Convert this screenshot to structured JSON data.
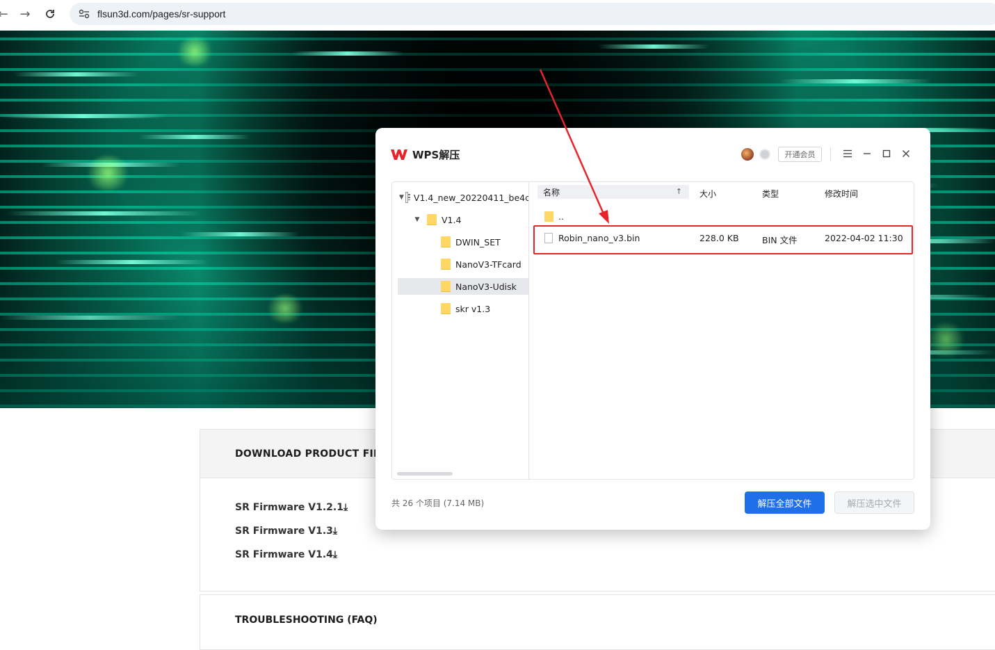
{
  "browser": {
    "url": "flsun3d.com/pages/sr-support"
  },
  "page": {
    "firmware_section_title": "DOWNLOAD PRODUCT FIRMWARE",
    "firmware_links": [
      "SR Firmware V1.2.1⤓",
      "SR Firmware V1.3⤓",
      "SR Firmware V1.4⤓"
    ],
    "faq_title": "TROUBLESHOOTING (FAQ)"
  },
  "dialog": {
    "title": "WPS解压",
    "vip_label": "开通会员",
    "tree": [
      {
        "label": "V1.4_new_20220411_be4c",
        "level": 0,
        "kind": "archive",
        "expanded": true
      },
      {
        "label": "V1.4",
        "level": 1,
        "kind": "folder",
        "expanded": true
      },
      {
        "label": "DWIN_SET",
        "level": 2,
        "kind": "folder"
      },
      {
        "label": "NanoV3-TFcard",
        "level": 2,
        "kind": "folder"
      },
      {
        "label": "NanoV3-Udisk",
        "level": 2,
        "kind": "folder",
        "selected": true
      },
      {
        "label": "skr v1.3",
        "level": 2,
        "kind": "folder"
      }
    ],
    "columns": {
      "name": "名称",
      "size": "大小",
      "type": "类型",
      "modified": "修改时间"
    },
    "rows": [
      {
        "name": "..",
        "size": "",
        "type": "",
        "modified": "",
        "kind": "folder"
      },
      {
        "name": "Robin_nano_v3.bin",
        "size": "228.0 KB",
        "type": "BIN 文件",
        "modified": "2022-04-02 11:30",
        "kind": "file"
      }
    ],
    "footer_count": "共 26 个项目 (7.14 MB)",
    "extract_all_label": "解压全部文件",
    "extract_selected_label": "解压选中文件"
  },
  "colors": {
    "accent": "#1f6fe8",
    "annotation": "#e8242b",
    "wps_logo": "#e8242b"
  }
}
